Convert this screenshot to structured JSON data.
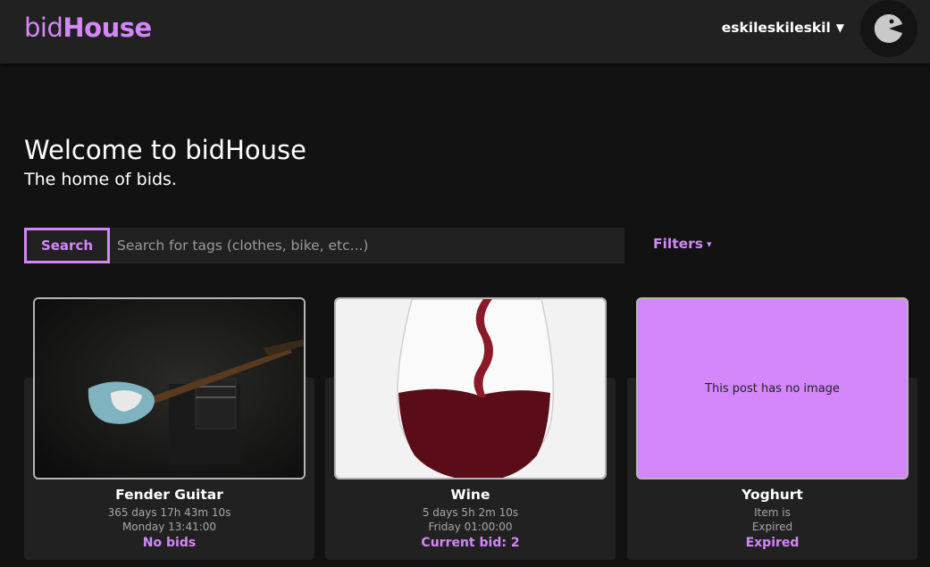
{
  "app": {
    "logo_light": "bid",
    "logo_bold": "House",
    "username": "eskileskileskil",
    "caret": "▼"
  },
  "hero": {
    "title": "Welcome to bidHouse",
    "subtitle": "The home of bids."
  },
  "search": {
    "button_label": "Search",
    "placeholder": "Search for tags (clothes, bike, etc...)",
    "value": ""
  },
  "filters": {
    "label": "Filters",
    "caret": "▾"
  },
  "colors": {
    "accent": "#d387fa",
    "background": "#121212",
    "surface": "#212121"
  },
  "cards": [
    {
      "title": "Fender Guitar",
      "line1": "365 days 17h 43m 10s",
      "line2": "Monday 13:41:00",
      "status": "No bids",
      "image": "guitar-photo"
    },
    {
      "title": "Wine",
      "line1": "5 days 5h 2m 10s",
      "line2": "Friday 01:00:00",
      "status": "Current bid: 2",
      "image": "wine-photo"
    },
    {
      "title": "Yoghurt",
      "line1": "Item is",
      "line2": "Expired",
      "status": "Expired",
      "image": "none",
      "no_image_text": "This post has no image"
    }
  ]
}
